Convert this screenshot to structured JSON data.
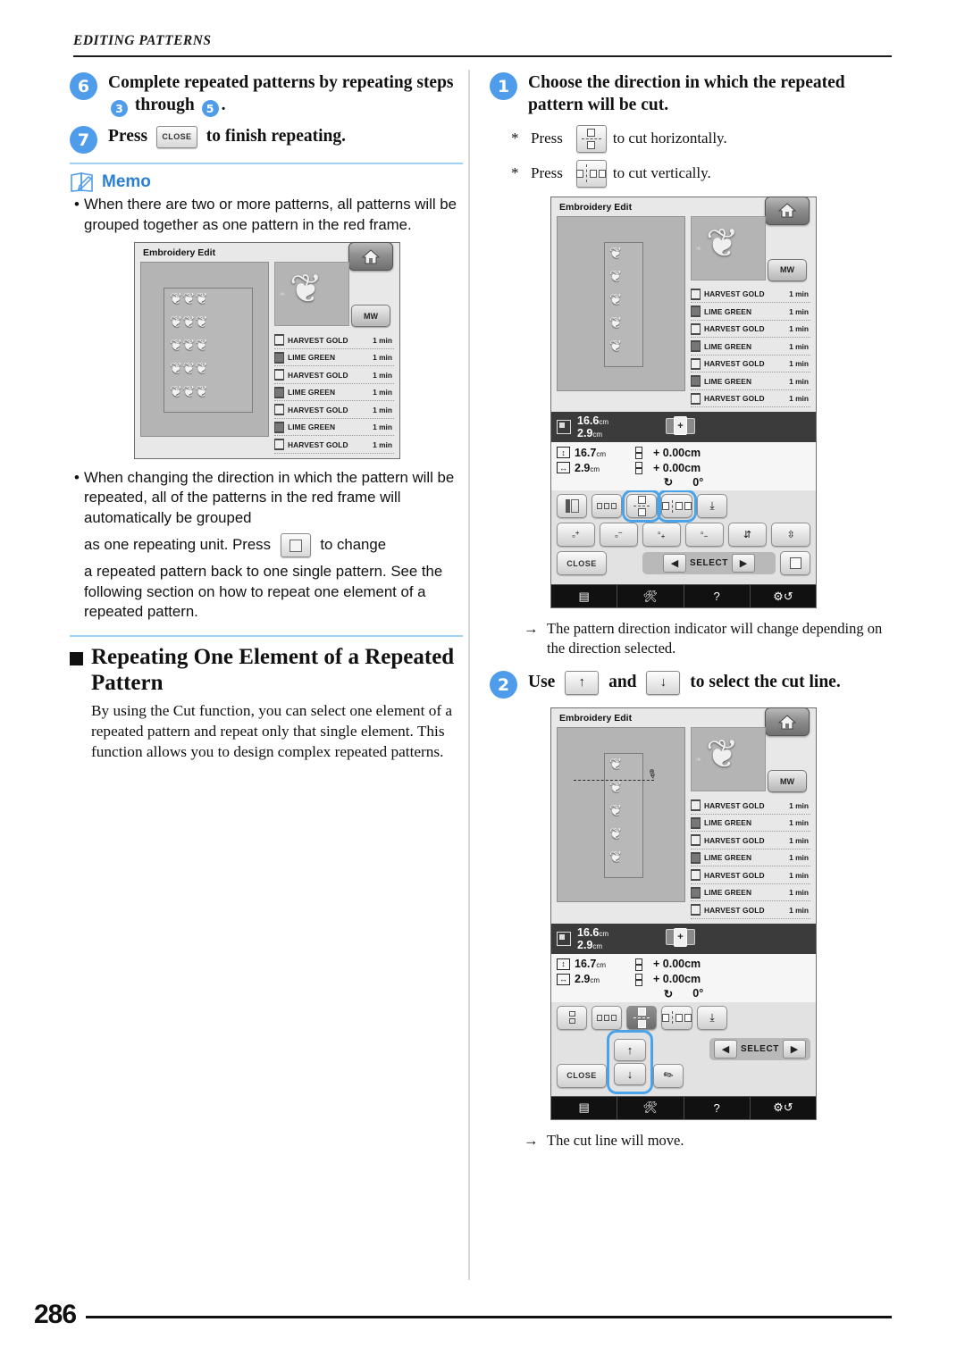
{
  "page": {
    "running_head": "EDITING PATTERNS",
    "number": "286"
  },
  "left_column": {
    "step6": {
      "badge": "6",
      "text_a": "Complete repeated patterns by repeating steps",
      "ref_a": "3",
      "text_b": "through",
      "ref_b": "5",
      "text_c": "."
    },
    "step7": {
      "badge": "7",
      "text_a": "Press",
      "key_label": "CLOSE",
      "text_b": "to finish repeating."
    },
    "memo": {
      "title": "Memo",
      "bullet1": "When there are two or more patterns, all patterns will be grouped together as one pattern in the red frame.",
      "bullet2_part1": "When changing the direction in which the pattern will be repeated, all of the patterns in the red frame will automatically be grouped",
      "bullet2_part2": "as one repeating unit. Press",
      "bullet2_part3": "to change",
      "bullet2_part4": "a repeated pattern back to one single pattern. See the following section on how to repeat one element of a repeated pattern."
    },
    "section": {
      "title": "Repeating One Element of a Repeated Pattern",
      "body": "By using the Cut function, you can select one element of a repeated pattern and repeat only that single element. This function allows you to design complex repeated patterns."
    }
  },
  "right_column": {
    "step1": {
      "badge": "1",
      "text": "Choose the direction in which the repeated pattern will be cut.",
      "note_h": {
        "mark": "*",
        "lead": "Press",
        "tail": "to cut horizontally."
      },
      "note_v": {
        "mark": "*",
        "lead": "Press",
        "tail": "to cut vertically."
      }
    },
    "note1": "The pattern direction indicator will change depending on the direction selected.",
    "step2": {
      "badge": "2",
      "text_a": "Use",
      "text_b": "and",
      "text_c": "to select the cut line."
    },
    "note2": "The cut line will move."
  },
  "screen": {
    "title": "Embroidery Edit",
    "home_icon": "home-icon",
    "mw_label": "MW",
    "threads": [
      {
        "name": "HARVEST GOLD",
        "time": "1 min",
        "color": "gold"
      },
      {
        "name": "LIME GREEN",
        "time": "1 min",
        "color": "green"
      },
      {
        "name": "HARVEST GOLD",
        "time": "1 min",
        "color": "gold"
      },
      {
        "name": "LIME GREEN",
        "time": "1 min",
        "color": "green"
      },
      {
        "name": "HARVEST GOLD",
        "time": "1 min",
        "color": "gold"
      },
      {
        "name": "LIME GREEN",
        "time": "1 min",
        "color": "green"
      },
      {
        "name": "HARVEST GOLD",
        "time": "1 min",
        "color": "gold"
      }
    ],
    "dims": {
      "overall_h": "16.6",
      "overall_w": "2.9",
      "unit": "cm",
      "size_h": "16.7",
      "size_w": "2.9",
      "offset_x": "+  0.00",
      "offset_y": "+  0.00",
      "rotation": "0°"
    },
    "buttons": {
      "close": "CLOSE",
      "select": "SELECT",
      "arrow_left": "◀",
      "arrow_right": "▶",
      "plus": "+",
      "minus": "−",
      "up_arrow": "↑",
      "down_arrow": "↓",
      "knife_icon": "knife-icon",
      "single_pattern_icon": "single-pattern-icon",
      "download_icon": "download-icon"
    },
    "taskbar": [
      "document-icon",
      "machine-icon",
      "?",
      "settings-icon"
    ]
  },
  "colors": {
    "accent_blue": "#4f9ceb",
    "memo_blue": "#2b7fd4",
    "rule_blue": "#9fd2f2",
    "highlight": "#4aa3e8",
    "screen_bg": "#e8e8e8",
    "canvas_gray": "#b4b4b4"
  }
}
